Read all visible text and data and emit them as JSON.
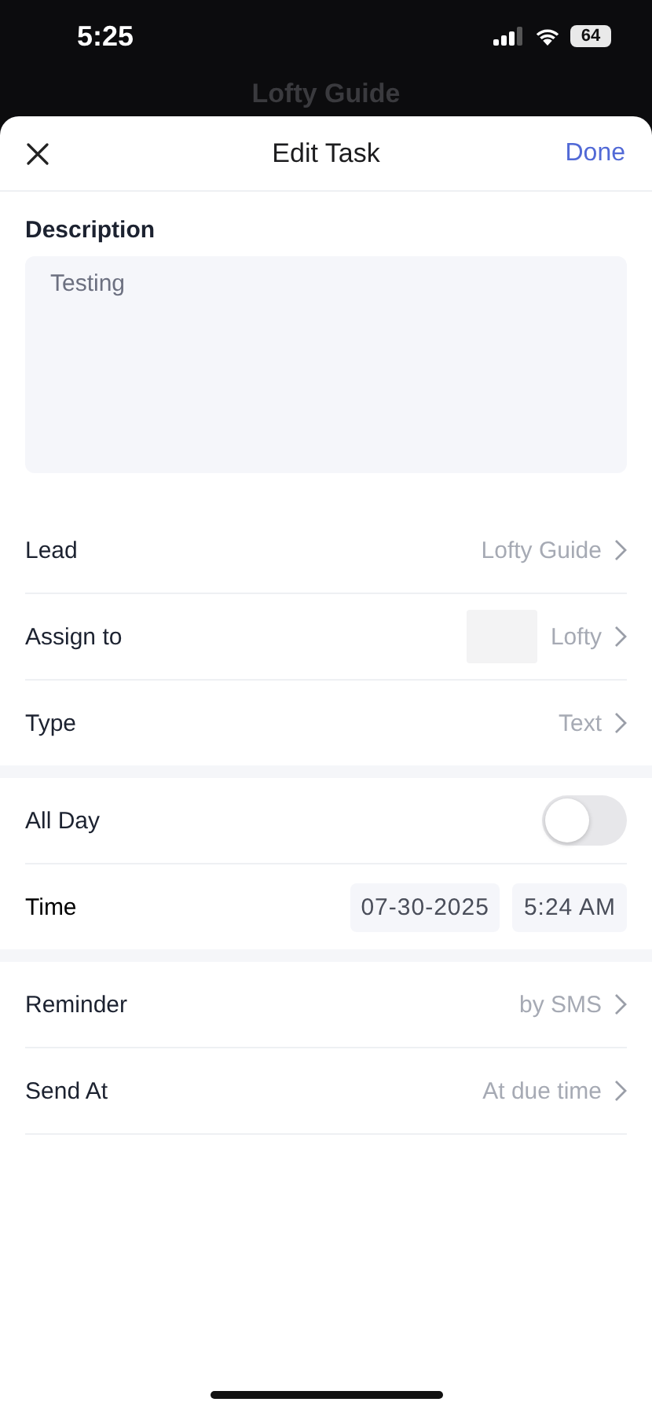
{
  "status_bar": {
    "time": "5:25",
    "battery": "64"
  },
  "background_title": "Lofty Guide",
  "header": {
    "title": "Edit Task",
    "done": "Done"
  },
  "description": {
    "label": "Description",
    "value": "Testing"
  },
  "sections": [
    {
      "rows": [
        {
          "kind": "link",
          "label": "Lead",
          "value": "Lofty Guide",
          "avatar": false
        },
        {
          "kind": "link",
          "label": "Assign to",
          "value": "Lofty",
          "avatar": true
        },
        {
          "kind": "link",
          "label": "Type",
          "value": "Text",
          "avatar": false
        }
      ]
    },
    {
      "rows": [
        {
          "kind": "toggle",
          "label": "All Day",
          "on": false
        },
        {
          "kind": "datetime",
          "label": "Time",
          "date": "07-30-2025",
          "time": "5:24 AM"
        }
      ]
    },
    {
      "rows": [
        {
          "kind": "link",
          "label": "Reminder",
          "value": "by SMS",
          "avatar": false
        },
        {
          "kind": "link",
          "label": "Send At",
          "value": "At due time",
          "avatar": false
        }
      ]
    }
  ]
}
